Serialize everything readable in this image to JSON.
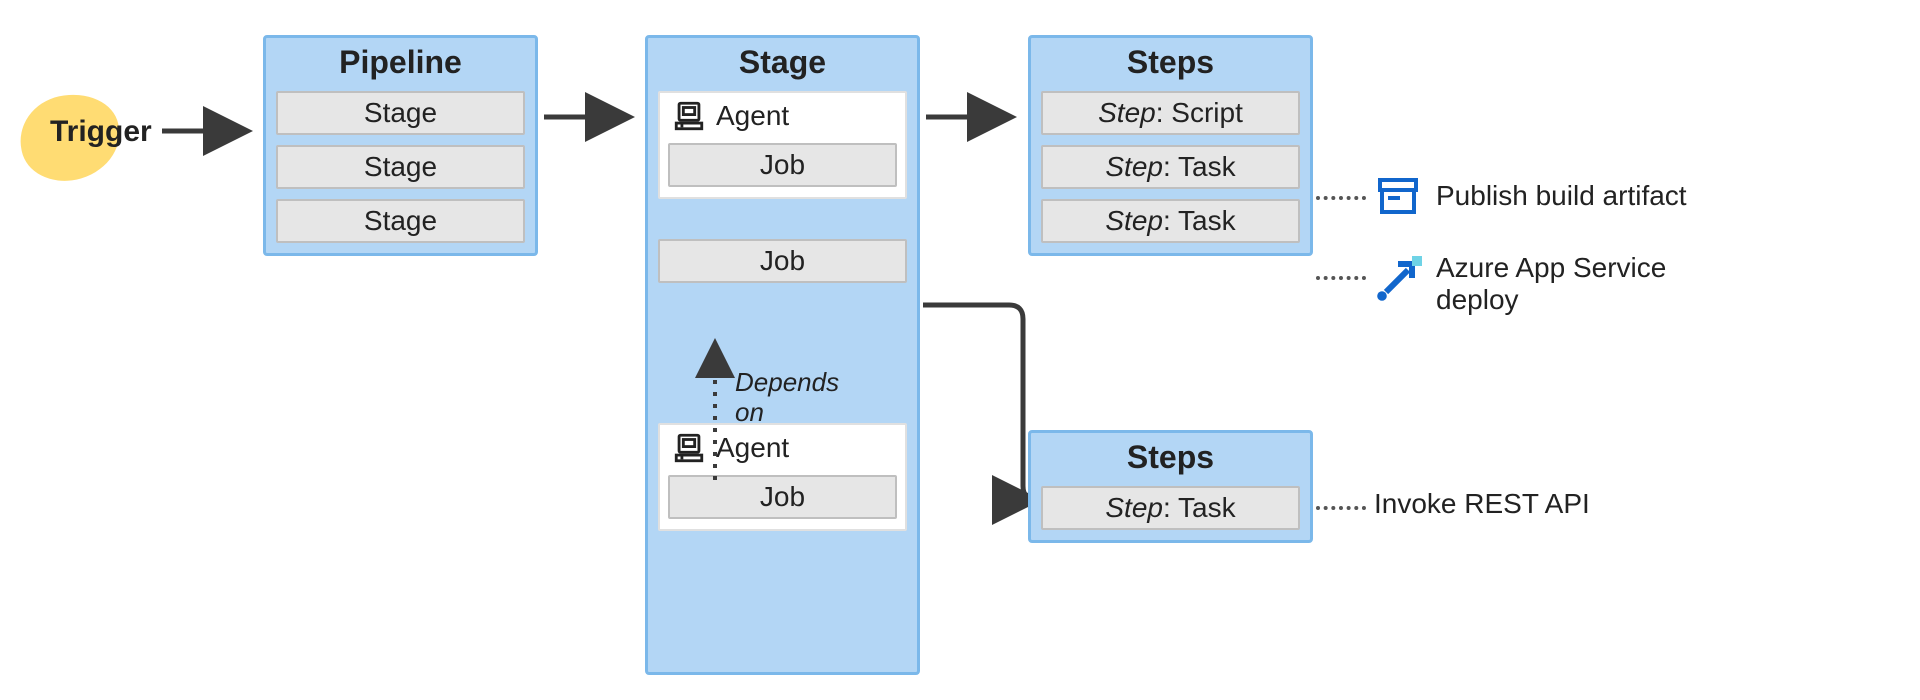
{
  "trigger": {
    "label": "Trigger"
  },
  "pipeline": {
    "title": "Pipeline",
    "stages": [
      "Stage",
      "Stage",
      "Stage"
    ]
  },
  "stage": {
    "title": "Stage",
    "agent1": {
      "label": "Agent",
      "job": "Job"
    },
    "mid_job": "Job",
    "depends_label": "Depends\non",
    "agent2": {
      "label": "Agent",
      "job": "Job"
    }
  },
  "steps1": {
    "title": "Steps",
    "items": [
      {
        "prefix": "Step",
        "value": "Script"
      },
      {
        "prefix": "Step",
        "value": "Task"
      },
      {
        "prefix": "Step",
        "value": "Task"
      }
    ]
  },
  "steps2": {
    "title": "Steps",
    "items": [
      {
        "prefix": "Step",
        "value": "Task"
      }
    ]
  },
  "annotations": {
    "publish": "Publish build artifact",
    "azure": "Azure App Service\ndeploy",
    "invoke": "Invoke REST API"
  }
}
